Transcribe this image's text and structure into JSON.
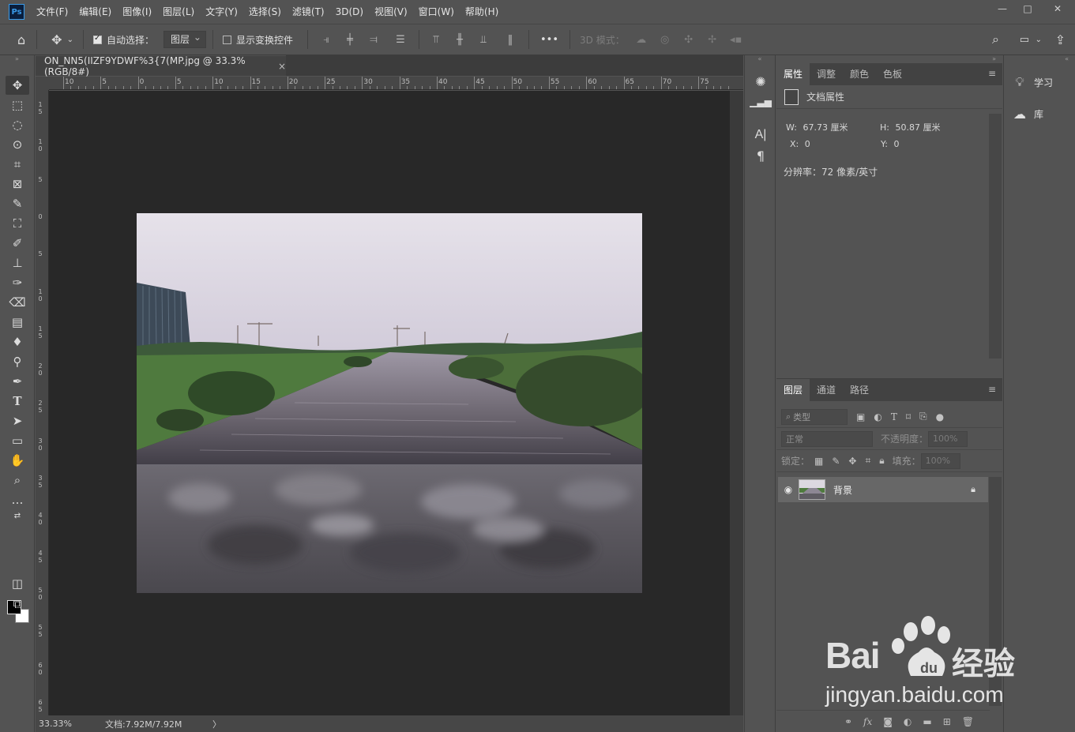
{
  "app": {
    "logo": "Ps"
  },
  "menu": [
    "文件(F)",
    "编辑(E)",
    "图像(I)",
    "图层(L)",
    "文字(Y)",
    "选择(S)",
    "滤镜(T)",
    "3D(D)",
    "视图(V)",
    "窗口(W)",
    "帮助(H)"
  ],
  "window_controls": {
    "minimize": "—",
    "maximize": "□",
    "close": "✕"
  },
  "options": {
    "auto_select_label": "自动选择：",
    "auto_select_checked": true,
    "auto_select_target": "图层",
    "show_transform_label": "显示变换控件",
    "show_transform_checked": false,
    "more": "•••",
    "mode_3d_label": "3D 模式："
  },
  "document": {
    "tab_title": "ON_NN5(IIZF9YDWF%3{7(MP.jpg @ 33.3%(RGB/8#)",
    "close": "×",
    "ruler_top": [
      "10",
      "5",
      "0",
      "5",
      "10",
      "15",
      "20",
      "25",
      "30",
      "35",
      "40",
      "45",
      "50",
      "55",
      "60",
      "65",
      "70",
      "75"
    ],
    "ruler_left": [
      "1 5",
      "1 0",
      "5",
      "0",
      "5",
      "1 0",
      "1 5",
      "2 0",
      "2 5",
      "3 0",
      "3 5",
      "4 0",
      "4 5",
      "5 0",
      "5 5",
      "6 0",
      "6 5"
    ]
  },
  "status": {
    "zoom": "33.33%",
    "doc_size": "文档:7.92M/7.92M",
    "arrow": "〉"
  },
  "properties_panel": {
    "tabs": [
      "属性",
      "调整",
      "颜色",
      "色板"
    ],
    "active_tab": 0,
    "section_title": "文档属性",
    "w_label": "W:",
    "w_value": "67.73 厘米",
    "h_label": "H:",
    "h_value": "50.87 厘米",
    "x_label": "X:",
    "x_value": "0",
    "y_label": "Y:",
    "y_value": "0",
    "resolution": "分辨率：72 像素/英寸"
  },
  "layers_panel": {
    "tabs": [
      "图层",
      "通道",
      "路径"
    ],
    "active_tab": 0,
    "filter_placeholder": "类型",
    "blend_mode": "正常",
    "opacity_label": "不透明度：",
    "opacity_value": "100%",
    "lock_label": "锁定：",
    "fill_label": "填充：",
    "fill_value": "100%",
    "layers": [
      {
        "name": "背景",
        "visible": true,
        "locked": true
      }
    ]
  },
  "learn_panel": {
    "learn_label": "学习",
    "library_label": "库"
  },
  "watermark": {
    "brand": "Bai",
    "brand_cn": "经验",
    "url": "jingyan.baidu.com"
  },
  "colors": {
    "accent": "#3a9ae8",
    "ui_bg": "#535353",
    "canvas_bg": "#282828"
  }
}
